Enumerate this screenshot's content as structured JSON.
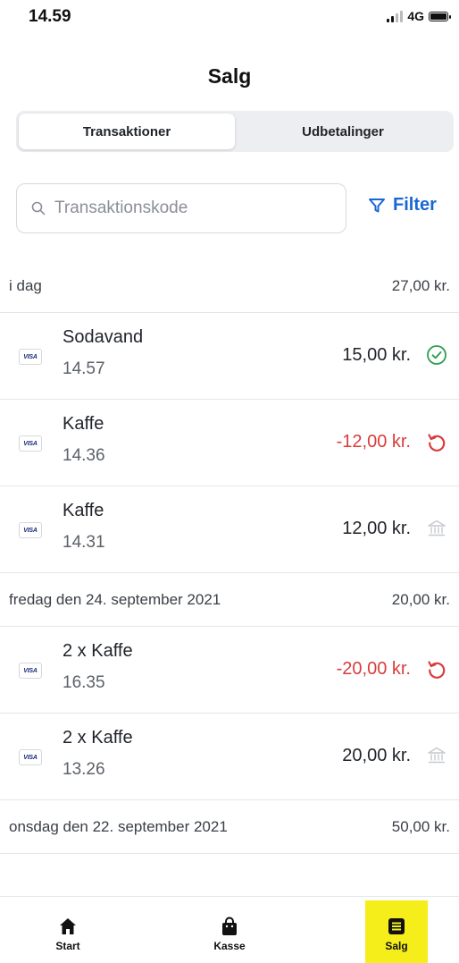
{
  "status_bar": {
    "time": "14.59",
    "network": "4G"
  },
  "header": {
    "title": "Salg"
  },
  "tabs": [
    {
      "label": "Transaktioner",
      "active": true
    },
    {
      "label": "Udbetalinger",
      "active": false
    }
  ],
  "search": {
    "placeholder": "Transaktionskode"
  },
  "filter": {
    "label": "Filter"
  },
  "sections": [
    {
      "title": "i dag",
      "total": "27,00 kr.",
      "rows": [
        {
          "card": "VISA",
          "name": "Sodavand",
          "time": "14.57",
          "amount": "15,00 kr.",
          "status": "check-circle-icon"
        },
        {
          "card": "VISA",
          "name": "Kaffe",
          "time": "14.36",
          "amount": "-12,00 kr.",
          "status": "refund-icon"
        },
        {
          "card": "VISA",
          "name": "Kaffe",
          "time": "14.31",
          "amount": "12,00 kr.",
          "status": "bank-icon"
        }
      ]
    },
    {
      "title": "fredag den 24. september 2021",
      "total": "20,00 kr.",
      "rows": [
        {
          "card": "VISA",
          "name": "2 x Kaffe",
          "time": "16.35",
          "amount": "-20,00 kr.",
          "status": "refund-icon"
        },
        {
          "card": "VISA",
          "name": "2 x Kaffe",
          "time": "13.26",
          "amount": "20,00 kr.",
          "status": "bank-icon"
        }
      ]
    },
    {
      "title": "onsdag den 22. september 2021",
      "total": "50,00 kr.",
      "rows": []
    }
  ],
  "bottom_nav": [
    {
      "label": "Start",
      "icon": "home-icon"
    },
    {
      "label": "Kasse",
      "icon": "shopping-bag-icon"
    },
    {
      "label": "Salg",
      "icon": "receipt-list-icon",
      "active": true
    }
  ],
  "colors": {
    "accent": "#1a66d6",
    "negative": "#d93c3c",
    "success": "#2e9e4f",
    "highlight": "#f5ee1a"
  }
}
